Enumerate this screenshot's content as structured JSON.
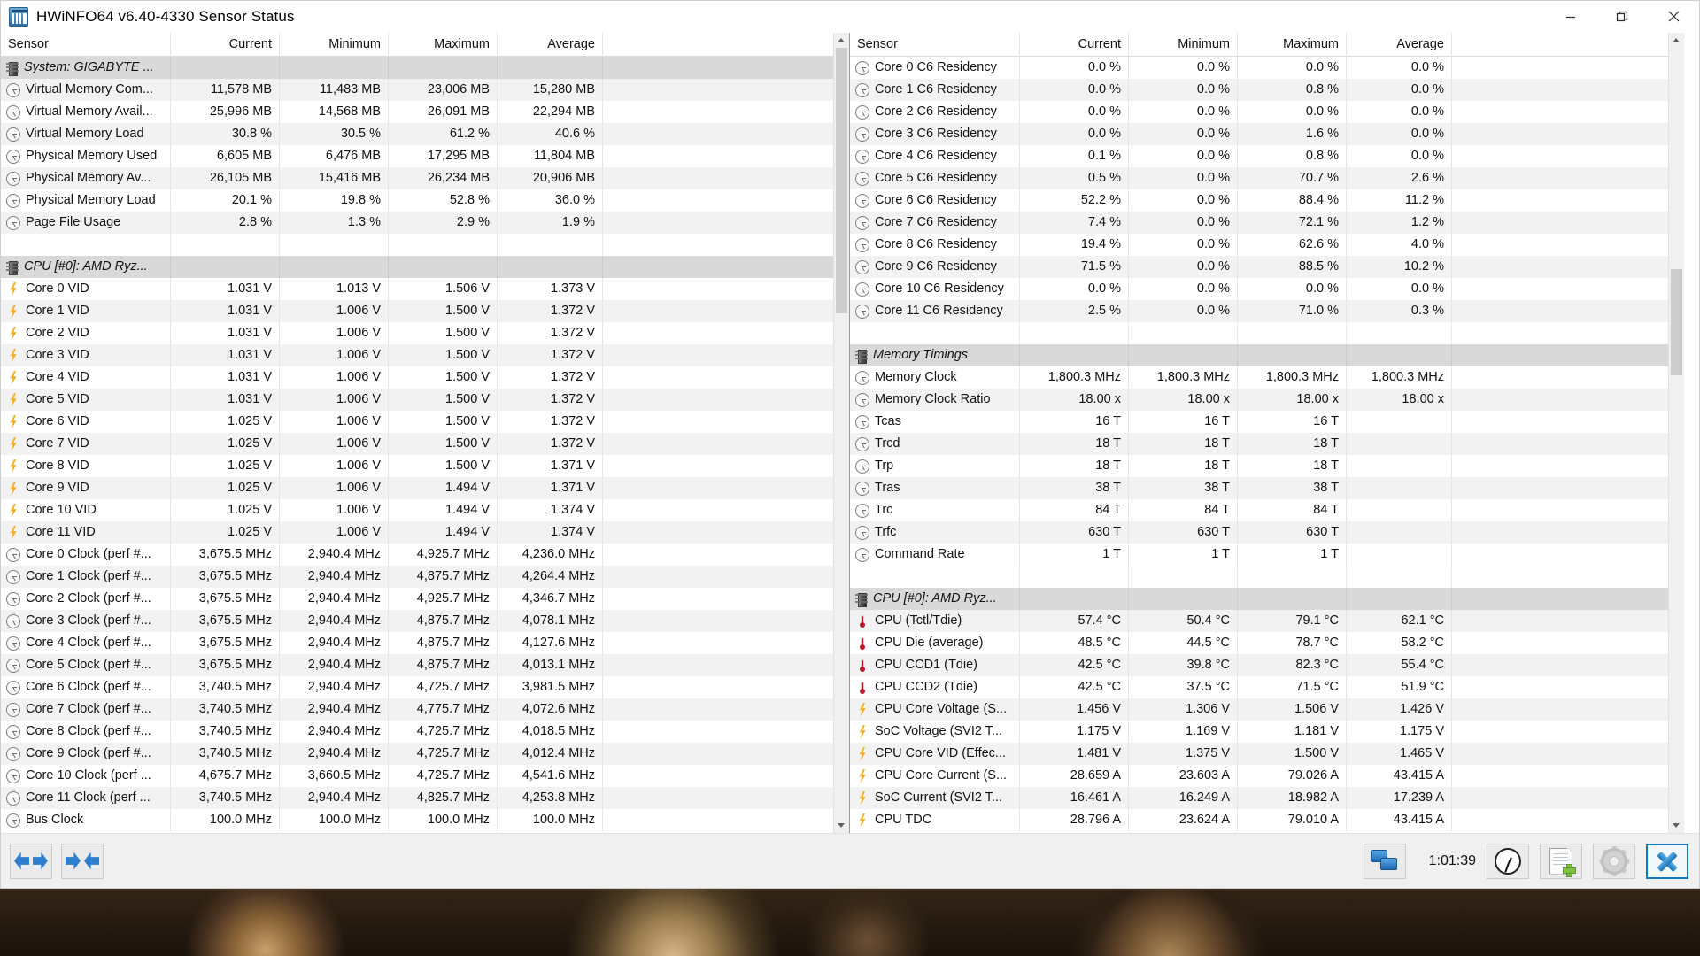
{
  "window": {
    "title": "HWiNFO64 v6.40-4330 Sensor Status",
    "app_icon": "hwinfo-icon",
    "minimize_label": "Minimize",
    "maximize_label": "Restore",
    "close_label": "Close"
  },
  "columns": [
    "Sensor",
    "Current",
    "Minimum",
    "Maximum",
    "Average"
  ],
  "left_pane": {
    "rows": [
      {
        "type": "group",
        "icon": "chip-icon",
        "label": "System: GIGABYTE ...",
        "values": [
          "",
          "",
          "",
          ""
        ]
      },
      {
        "type": "data",
        "icon": "gauge-icon",
        "label": "Virtual Memory Com...",
        "values": [
          "11,578 MB",
          "11,483 MB",
          "23,006 MB",
          "15,280 MB"
        ]
      },
      {
        "type": "data",
        "icon": "gauge-icon",
        "label": "Virtual Memory Avail...",
        "values": [
          "25,996 MB",
          "14,568 MB",
          "26,091 MB",
          "22,294 MB"
        ]
      },
      {
        "type": "data",
        "icon": "gauge-icon",
        "label": "Virtual Memory Load",
        "values": [
          "30.8 %",
          "30.5 %",
          "61.2 %",
          "40.6 %"
        ]
      },
      {
        "type": "data",
        "icon": "gauge-icon",
        "label": "Physical Memory Used",
        "values": [
          "6,605 MB",
          "6,476 MB",
          "17,295 MB",
          "11,804 MB"
        ]
      },
      {
        "type": "data",
        "icon": "gauge-icon",
        "label": "Physical Memory Av...",
        "values": [
          "26,105 MB",
          "15,416 MB",
          "26,234 MB",
          "20,906 MB"
        ]
      },
      {
        "type": "data",
        "icon": "gauge-icon",
        "label": "Physical Memory Load",
        "values": [
          "20.1 %",
          "19.8 %",
          "52.8 %",
          "36.0 %"
        ]
      },
      {
        "type": "data",
        "icon": "gauge-icon",
        "label": "Page File Usage",
        "values": [
          "2.8 %",
          "1.3 %",
          "2.9 %",
          "1.9 %"
        ]
      },
      {
        "type": "blank",
        "icon": "",
        "label": "",
        "values": [
          "",
          "",
          "",
          ""
        ]
      },
      {
        "type": "group",
        "icon": "chip-icon",
        "label": "CPU [#0]: AMD Ryz...",
        "values": [
          "",
          "",
          "",
          ""
        ]
      },
      {
        "type": "data",
        "icon": "bolt-icon",
        "label": "Core 0 VID",
        "values": [
          "1.031 V",
          "1.013 V",
          "1.506 V",
          "1.373 V"
        ]
      },
      {
        "type": "data",
        "icon": "bolt-icon",
        "label": "Core 1 VID",
        "values": [
          "1.031 V",
          "1.006 V",
          "1.500 V",
          "1.372 V"
        ]
      },
      {
        "type": "data",
        "icon": "bolt-icon",
        "label": "Core 2 VID",
        "values": [
          "1.031 V",
          "1.006 V",
          "1.500 V",
          "1.372 V"
        ]
      },
      {
        "type": "data",
        "icon": "bolt-icon",
        "label": "Core 3 VID",
        "values": [
          "1.031 V",
          "1.006 V",
          "1.500 V",
          "1.372 V"
        ]
      },
      {
        "type": "data",
        "icon": "bolt-icon",
        "label": "Core 4 VID",
        "values": [
          "1.031 V",
          "1.006 V",
          "1.500 V",
          "1.372 V"
        ]
      },
      {
        "type": "data",
        "icon": "bolt-icon",
        "label": "Core 5 VID",
        "values": [
          "1.031 V",
          "1.006 V",
          "1.500 V",
          "1.372 V"
        ]
      },
      {
        "type": "data",
        "icon": "bolt-icon",
        "label": "Core 6 VID",
        "values": [
          "1.025 V",
          "1.006 V",
          "1.500 V",
          "1.372 V"
        ]
      },
      {
        "type": "data",
        "icon": "bolt-icon",
        "label": "Core 7 VID",
        "values": [
          "1.025 V",
          "1.006 V",
          "1.500 V",
          "1.372 V"
        ]
      },
      {
        "type": "data",
        "icon": "bolt-icon",
        "label": "Core 8 VID",
        "values": [
          "1.025 V",
          "1.006 V",
          "1.500 V",
          "1.371 V"
        ]
      },
      {
        "type": "data",
        "icon": "bolt-icon",
        "label": "Core 9 VID",
        "values": [
          "1.025 V",
          "1.006 V",
          "1.494 V",
          "1.371 V"
        ]
      },
      {
        "type": "data",
        "icon": "bolt-icon",
        "label": "Core 10 VID",
        "values": [
          "1.025 V",
          "1.006 V",
          "1.494 V",
          "1.374 V"
        ]
      },
      {
        "type": "data",
        "icon": "bolt-icon",
        "label": "Core 11 VID",
        "values": [
          "1.025 V",
          "1.006 V",
          "1.494 V",
          "1.374 V"
        ]
      },
      {
        "type": "data",
        "icon": "gauge-icon",
        "label": "Core 0 Clock (perf #...",
        "values": [
          "3,675.5 MHz",
          "2,940.4 MHz",
          "4,925.7 MHz",
          "4,236.0 MHz"
        ]
      },
      {
        "type": "data",
        "icon": "gauge-icon",
        "label": "Core 1 Clock (perf #...",
        "values": [
          "3,675.5 MHz",
          "2,940.4 MHz",
          "4,875.7 MHz",
          "4,264.4 MHz"
        ]
      },
      {
        "type": "data",
        "icon": "gauge-icon",
        "label": "Core 2 Clock (perf #...",
        "values": [
          "3,675.5 MHz",
          "2,940.4 MHz",
          "4,925.7 MHz",
          "4,346.7 MHz"
        ]
      },
      {
        "type": "data",
        "icon": "gauge-icon",
        "label": "Core 3 Clock (perf #...",
        "values": [
          "3,675.5 MHz",
          "2,940.4 MHz",
          "4,875.7 MHz",
          "4,078.1 MHz"
        ]
      },
      {
        "type": "data",
        "icon": "gauge-icon",
        "label": "Core 4 Clock (perf #...",
        "values": [
          "3,675.5 MHz",
          "2,940.4 MHz",
          "4,875.7 MHz",
          "4,127.6 MHz"
        ]
      },
      {
        "type": "data",
        "icon": "gauge-icon",
        "label": "Core 5 Clock (perf #...",
        "values": [
          "3,675.5 MHz",
          "2,940.4 MHz",
          "4,875.7 MHz",
          "4,013.1 MHz"
        ]
      },
      {
        "type": "data",
        "icon": "gauge-icon",
        "label": "Core 6 Clock (perf #...",
        "values": [
          "3,740.5 MHz",
          "2,940.4 MHz",
          "4,725.7 MHz",
          "3,981.5 MHz"
        ]
      },
      {
        "type": "data",
        "icon": "gauge-icon",
        "label": "Core 7 Clock (perf #...",
        "values": [
          "3,740.5 MHz",
          "2,940.4 MHz",
          "4,775.7 MHz",
          "4,072.6 MHz"
        ]
      },
      {
        "type": "data",
        "icon": "gauge-icon",
        "label": "Core 8 Clock (perf #...",
        "values": [
          "3,740.5 MHz",
          "2,940.4 MHz",
          "4,725.7 MHz",
          "4,018.5 MHz"
        ]
      },
      {
        "type": "data",
        "icon": "gauge-icon",
        "label": "Core 9 Clock (perf #...",
        "values": [
          "3,740.5 MHz",
          "2,940.4 MHz",
          "4,725.7 MHz",
          "4,012.4 MHz"
        ]
      },
      {
        "type": "data",
        "icon": "gauge-icon",
        "label": "Core 10 Clock (perf ...",
        "values": [
          "4,675.7 MHz",
          "3,660.5 MHz",
          "4,725.7 MHz",
          "4,541.6 MHz"
        ]
      },
      {
        "type": "data",
        "icon": "gauge-icon",
        "label": "Core 11 Clock (perf ...",
        "values": [
          "3,740.5 MHz",
          "2,940.4 MHz",
          "4,825.7 MHz",
          "4,253.8 MHz"
        ]
      },
      {
        "type": "data",
        "icon": "gauge-icon",
        "label": "Bus Clock",
        "values": [
          "100.0 MHz",
          "100.0 MHz",
          "100.0 MHz",
          "100.0 MHz"
        ]
      }
    ]
  },
  "right_pane": {
    "rows": [
      {
        "type": "data",
        "icon": "gauge-icon",
        "label": "Core 0 C6 Residency",
        "values": [
          "0.0 %",
          "0.0 %",
          "0.0 %",
          "0.0 %"
        ]
      },
      {
        "type": "data",
        "icon": "gauge-icon",
        "label": "Core 1 C6 Residency",
        "values": [
          "0.0 %",
          "0.0 %",
          "0.8 %",
          "0.0 %"
        ]
      },
      {
        "type": "data",
        "icon": "gauge-icon",
        "label": "Core 2 C6 Residency",
        "values": [
          "0.0 %",
          "0.0 %",
          "0.0 %",
          "0.0 %"
        ]
      },
      {
        "type": "data",
        "icon": "gauge-icon",
        "label": "Core 3 C6 Residency",
        "values": [
          "0.0 %",
          "0.0 %",
          "1.6 %",
          "0.0 %"
        ]
      },
      {
        "type": "data",
        "icon": "gauge-icon",
        "label": "Core 4 C6 Residency",
        "values": [
          "0.1 %",
          "0.0 %",
          "0.8 %",
          "0.0 %"
        ]
      },
      {
        "type": "data",
        "icon": "gauge-icon",
        "label": "Core 5 C6 Residency",
        "values": [
          "0.5 %",
          "0.0 %",
          "70.7 %",
          "2.6 %"
        ]
      },
      {
        "type": "data",
        "icon": "gauge-icon",
        "label": "Core 6 C6 Residency",
        "values": [
          "52.2 %",
          "0.0 %",
          "88.4 %",
          "11.2 %"
        ]
      },
      {
        "type": "data",
        "icon": "gauge-icon",
        "label": "Core 7 C6 Residency",
        "values": [
          "7.4 %",
          "0.0 %",
          "72.1 %",
          "1.2 %"
        ]
      },
      {
        "type": "data",
        "icon": "gauge-icon",
        "label": "Core 8 C6 Residency",
        "values": [
          "19.4 %",
          "0.0 %",
          "62.6 %",
          "4.0 %"
        ]
      },
      {
        "type": "data",
        "icon": "gauge-icon",
        "label": "Core 9 C6 Residency",
        "values": [
          "71.5 %",
          "0.0 %",
          "88.5 %",
          "10.2 %"
        ]
      },
      {
        "type": "data",
        "icon": "gauge-icon",
        "label": "Core 10 C6 Residency",
        "values": [
          "0.0 %",
          "0.0 %",
          "0.0 %",
          "0.0 %"
        ]
      },
      {
        "type": "data",
        "icon": "gauge-icon",
        "label": "Core 11 C6 Residency",
        "values": [
          "2.5 %",
          "0.0 %",
          "71.0 %",
          "0.3 %"
        ]
      },
      {
        "type": "blank",
        "icon": "",
        "label": "",
        "values": [
          "",
          "",
          "",
          ""
        ]
      },
      {
        "type": "group",
        "icon": "chip-icon",
        "label": "Memory Timings",
        "values": [
          "",
          "",
          "",
          ""
        ]
      },
      {
        "type": "data",
        "icon": "gauge-icon",
        "label": "Memory Clock",
        "values": [
          "1,800.3 MHz",
          "1,800.3 MHz",
          "1,800.3 MHz",
          "1,800.3 MHz"
        ]
      },
      {
        "type": "data",
        "icon": "gauge-icon",
        "label": "Memory Clock Ratio",
        "values": [
          "18.00 x",
          "18.00 x",
          "18.00 x",
          "18.00 x"
        ]
      },
      {
        "type": "data",
        "icon": "gauge-icon",
        "label": "Tcas",
        "values": [
          "16 T",
          "16 T",
          "16 T",
          ""
        ]
      },
      {
        "type": "data",
        "icon": "gauge-icon",
        "label": "Trcd",
        "values": [
          "18 T",
          "18 T",
          "18 T",
          ""
        ]
      },
      {
        "type": "data",
        "icon": "gauge-icon",
        "label": "Trp",
        "values": [
          "18 T",
          "18 T",
          "18 T",
          ""
        ]
      },
      {
        "type": "data",
        "icon": "gauge-icon",
        "label": "Tras",
        "values": [
          "38 T",
          "38 T",
          "38 T",
          ""
        ]
      },
      {
        "type": "data",
        "icon": "gauge-icon",
        "label": "Trc",
        "values": [
          "84 T",
          "84 T",
          "84 T",
          ""
        ]
      },
      {
        "type": "data",
        "icon": "gauge-icon",
        "label": "Trfc",
        "values": [
          "630 T",
          "630 T",
          "630 T",
          ""
        ]
      },
      {
        "type": "data",
        "icon": "gauge-icon",
        "label": "Command Rate",
        "values": [
          "1 T",
          "1 T",
          "1 T",
          ""
        ]
      },
      {
        "type": "blank",
        "icon": "",
        "label": "",
        "values": [
          "",
          "",
          "",
          ""
        ]
      },
      {
        "type": "group",
        "icon": "chip-icon",
        "label": "CPU [#0]: AMD Ryz...",
        "values": [
          "",
          "",
          "",
          ""
        ]
      },
      {
        "type": "data",
        "icon": "thermometer-icon",
        "label": "CPU (Tctl/Tdie)",
        "values": [
          "57.4 °C",
          "50.4 °C",
          "79.1 °C",
          "62.1 °C"
        ]
      },
      {
        "type": "data",
        "icon": "thermometer-icon",
        "label": "CPU Die (average)",
        "values": [
          "48.5 °C",
          "44.5 °C",
          "78.7 °C",
          "58.2 °C"
        ]
      },
      {
        "type": "data",
        "icon": "thermometer-icon",
        "label": "CPU CCD1 (Tdie)",
        "values": [
          "42.5 °C",
          "39.8 °C",
          "82.3 °C",
          "55.4 °C"
        ]
      },
      {
        "type": "data",
        "icon": "thermometer-icon",
        "label": "CPU CCD2 (Tdie)",
        "values": [
          "42.5 °C",
          "37.5 °C",
          "71.5 °C",
          "51.9 °C"
        ]
      },
      {
        "type": "data",
        "icon": "bolt-icon",
        "label": "CPU Core Voltage (S...",
        "values": [
          "1.456 V",
          "1.306 V",
          "1.506 V",
          "1.426 V"
        ]
      },
      {
        "type": "data",
        "icon": "bolt-icon",
        "label": "SoC Voltage (SVI2 T...",
        "values": [
          "1.175 V",
          "1.169 V",
          "1.181 V",
          "1.175 V"
        ]
      },
      {
        "type": "data",
        "icon": "bolt-icon",
        "label": "CPU Core VID (Effec...",
        "values": [
          "1.481 V",
          "1.375 V",
          "1.500 V",
          "1.465 V"
        ]
      },
      {
        "type": "data",
        "icon": "bolt-icon",
        "label": "CPU Core Current (S...",
        "values": [
          "28.659 A",
          "23.603 A",
          "79.026 A",
          "43.415 A"
        ]
      },
      {
        "type": "data",
        "icon": "bolt-icon",
        "label": "SoC Current (SVI2 T...",
        "values": [
          "16.461 A",
          "16.249 A",
          "18.982 A",
          "17.239 A"
        ]
      },
      {
        "type": "data",
        "icon": "bolt-icon",
        "label": "CPU TDC",
        "values": [
          "28.796 A",
          "23.624 A",
          "79.010 A",
          "43.415 A"
        ]
      }
    ]
  },
  "toolbar": {
    "prev_button": "prev-sensors-button",
    "next_button": "next-sensors-button",
    "remote_button": "remote-monitoring-button",
    "elapsed": "1:01:39",
    "clock_button": "polling-period-button",
    "report_button": "create-report-button",
    "settings_button": "settings-button",
    "close_button": "close-sensors-button"
  },
  "colors": {
    "accent": "#1278c4",
    "group_row": "#d9d9d9",
    "alt_row": "#f2f2f2",
    "temp_icon": "#c0182b",
    "volt_icon": "#f2a91b"
  }
}
